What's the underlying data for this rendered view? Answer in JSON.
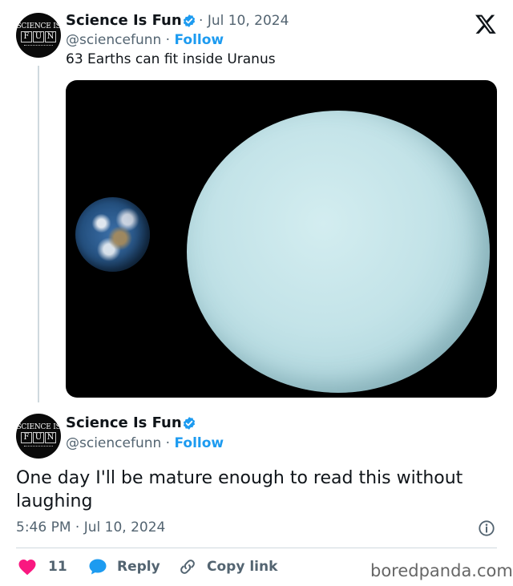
{
  "original_tweet": {
    "author_name": "Science Is Fun",
    "date": "Jul 10, 2024",
    "handle": "@sciencefunn",
    "follow_label": "Follow",
    "text": "63 Earths can fit inside Uranus",
    "avatar": {
      "line1": "SCIENCE IS",
      "letters": [
        "F",
        "U",
        "N"
      ]
    }
  },
  "reply_tweet": {
    "author_name": "Science Is Fun",
    "handle": "@sciencefunn",
    "follow_label": "Follow",
    "text": "One day I'll be mature enough to read this without laughing",
    "timestamp": "5:46 PM · Jul 10, 2024",
    "avatar": {
      "line1": "SCIENCE IS",
      "letters": [
        "F",
        "U",
        "N"
      ]
    }
  },
  "actions": {
    "like_count": "11",
    "reply_label": "Reply",
    "copy_link_label": "Copy link"
  },
  "watermark": "boredpanda.com",
  "colors": {
    "accent": "#1d9bf0",
    "like": "#f91880",
    "secondary_text": "#536471",
    "divider": "#cfd9de"
  },
  "icons": [
    "x-logo-icon",
    "verified-badge-icon",
    "heart-icon",
    "reply-bubble-icon",
    "link-icon",
    "info-icon"
  ]
}
